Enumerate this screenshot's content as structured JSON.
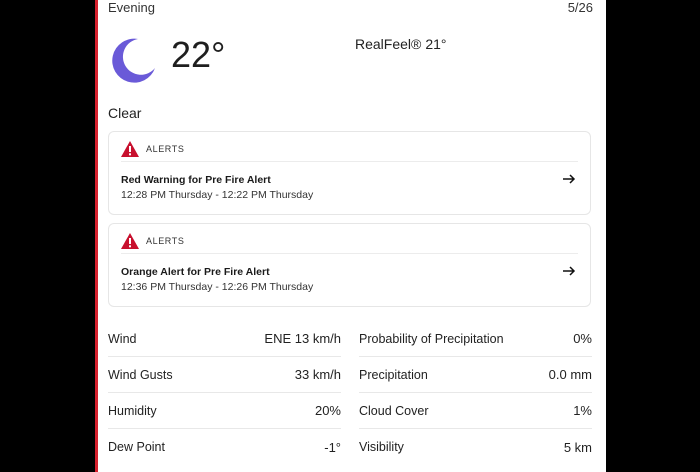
{
  "header": {
    "period": "Evening",
    "date": "5/26"
  },
  "current": {
    "icon": "moon-icon",
    "temperature": "22°",
    "realfeel_label": "RealFeel®",
    "realfeel_value": "21°",
    "condition": "Clear"
  },
  "alerts": [
    {
      "tag": "ALERTS",
      "title": "Red Warning for Pre Fire Alert",
      "time": "12:28 PM Thursday - 12:22 PM Thursday"
    },
    {
      "tag": "ALERTS",
      "title": "Orange Alert for Pre Fire Alert",
      "time": "12:36 PM Thursday - 12:26 PM Thursday"
    }
  ],
  "details_left": [
    {
      "label": "Wind",
      "value": "ENE 13 km/h"
    },
    {
      "label": "Wind Gusts",
      "value": "33 km/h"
    },
    {
      "label": "Humidity",
      "value": "20%"
    },
    {
      "label": "Dew Point",
      "value": "-1°"
    }
  ],
  "details_right": [
    {
      "label": "Probability of Precipitation",
      "value": "0%"
    },
    {
      "label": "Precipitation",
      "value": "0.0 mm"
    },
    {
      "label": "Cloud Cover",
      "value": "1%"
    },
    {
      "label": "Visibility",
      "value": "5 km"
    }
  ],
  "colors": {
    "accent": "#d6212e",
    "moon": "#6a5ad8"
  }
}
